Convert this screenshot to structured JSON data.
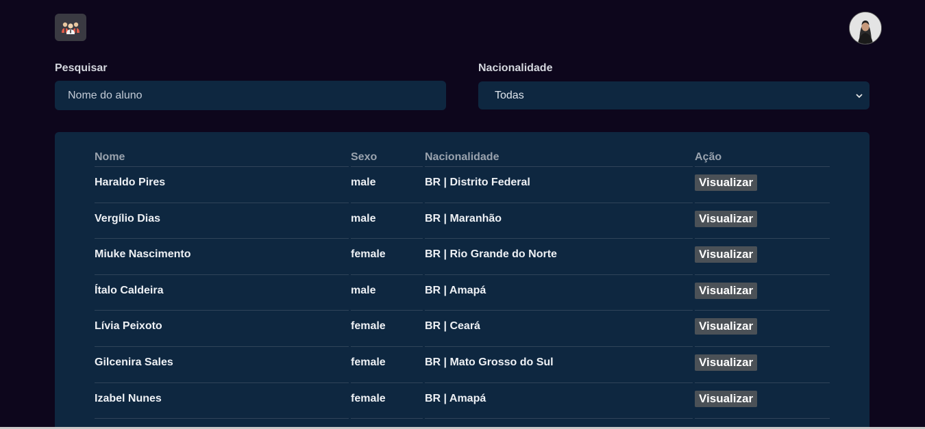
{
  "header": {
    "logo_icon": "people-group-icon",
    "avatar_icon": "user-avatar"
  },
  "search": {
    "label": "Pesquisar",
    "placeholder": "Nome do aluno",
    "value": ""
  },
  "nationality": {
    "label": "Nacionalidade",
    "selected": "Todas"
  },
  "table": {
    "headers": {
      "name": "Nome",
      "sex": "Sexo",
      "nationality": "Nacionalidade",
      "action": "Ação"
    },
    "rows": [
      {
        "name": "Haraldo Pires",
        "sex": "male",
        "nationality": "BR | Distrito Federal",
        "action": "Visualizar"
      },
      {
        "name": "Vergílio Dias",
        "sex": "male",
        "nationality": "BR | Maranhão",
        "action": "Visualizar"
      },
      {
        "name": "Miuke Nascimento",
        "sex": "female",
        "nationality": "BR | Rio Grande do Norte",
        "action": "Visualizar"
      },
      {
        "name": "Ítalo Caldeira",
        "sex": "male",
        "nationality": "BR | Amapá",
        "action": "Visualizar"
      },
      {
        "name": "Lívia Peixoto",
        "sex": "female",
        "nationality": "BR | Ceará",
        "action": "Visualizar"
      },
      {
        "name": "Gilcenira Sales",
        "sex": "female",
        "nationality": "BR | Mato Grosso do Sul",
        "action": "Visualizar"
      },
      {
        "name": "Izabel Nunes",
        "sex": "female",
        "nationality": "BR | Amapá",
        "action": "Visualizar"
      }
    ]
  },
  "colors": {
    "background": "#0d061c",
    "panel": "#0e2740",
    "button": "#4b5157"
  }
}
